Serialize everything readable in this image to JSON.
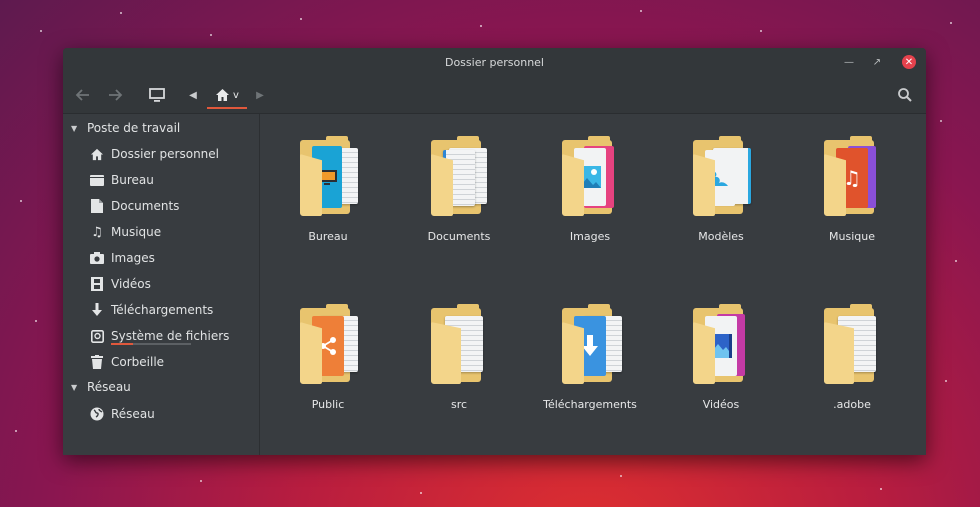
{
  "window": {
    "title": "Dossier personnel",
    "controls": [
      "minimize-icon",
      "maximize-icon",
      "close-icon"
    ]
  },
  "toolbar": {
    "path_home_suffix": "v"
  },
  "sidebar": {
    "sections": [
      {
        "label": "Poste de travail",
        "items": [
          {
            "label": "Dossier personnel",
            "icon": "home-icon"
          },
          {
            "label": "Bureau",
            "icon": "desktop-folder-icon"
          },
          {
            "label": "Documents",
            "icon": "document-icon"
          },
          {
            "label": "Musique",
            "icon": "music-note-icon"
          },
          {
            "label": "Images",
            "icon": "camera-icon"
          },
          {
            "label": "Vidéos",
            "icon": "film-icon"
          },
          {
            "label": "Téléchargements",
            "icon": "download-arrow-icon"
          },
          {
            "label": "Système de fichiers",
            "icon": "hard-drive-icon"
          },
          {
            "label": "Corbeille",
            "icon": "trash-icon"
          }
        ]
      },
      {
        "label": "Réseau",
        "items": [
          {
            "label": "Réseau",
            "icon": "globe-icon"
          }
        ]
      }
    ],
    "filesystem_usage": 0.28
  },
  "folders": [
    {
      "label": "Bureau",
      "icon": "folder-desktop-icon",
      "accent": "#1aa3d5"
    },
    {
      "label": "Documents",
      "icon": "folder-documents-icon",
      "accent": "#2f86d4"
    },
    {
      "label": "Images",
      "icon": "folder-pictures-icon",
      "accent": "#e6427f"
    },
    {
      "label": "Modèles",
      "icon": "folder-templates-icon",
      "accent": "#2aa7e0"
    },
    {
      "label": "Musique",
      "icon": "folder-music-icon",
      "accent": "#e0532c"
    },
    {
      "label": "Public",
      "icon": "folder-public-icon",
      "accent": "#ee7f38"
    },
    {
      "label": "src",
      "icon": "folder-icon",
      "accent": "#e8c46e"
    },
    {
      "label": "Téléchargements",
      "icon": "folder-download-icon",
      "accent": "#3a93e0"
    },
    {
      "label": "Vidéos",
      "icon": "folder-videos-icon",
      "accent": "#c43aa5"
    },
    {
      "label": ".adobe",
      "icon": "folder-icon",
      "accent": "#e8c46e"
    }
  ],
  "colors": {
    "window_bg": "#383c40",
    "header_bg": "#33373a",
    "accent": "#e0583c",
    "text": "#e1e3e4"
  }
}
